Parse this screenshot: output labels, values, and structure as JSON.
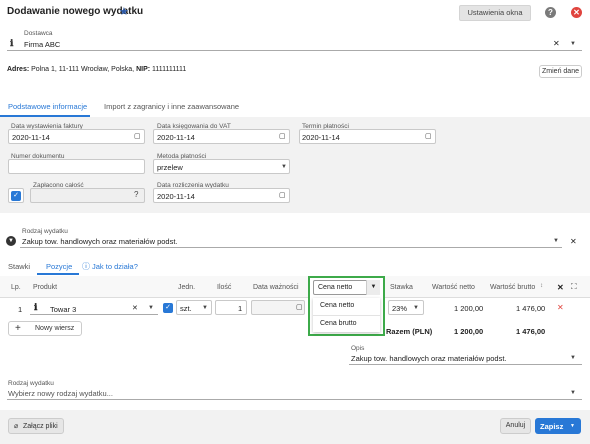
{
  "window": {
    "title": "Dodawanie nowego wydatku",
    "settings_label": "Ustawienia okna",
    "help_glyph": "?",
    "close_glyph": "✕"
  },
  "supplier": {
    "label": "Dostawca",
    "value": "Firma ABC",
    "address_prefix": "Adres:",
    "address": "Polna 1, 11-111 Wrocław, Polska,",
    "nip_label": "NIP:",
    "nip": "1111111111",
    "change_label": "Zmień dane"
  },
  "tabs": [
    "Podstawowe informacje",
    "Import z zagranicy i inne zaawansowane"
  ],
  "form": {
    "invoice_date_label": "Data wystawienia faktury",
    "invoice_date": "2020-11-14",
    "vat_date_label": "Data księgowania do VAT",
    "vat_date": "2020-11-14",
    "due_date_label": "Termin płatności",
    "due_date": "2020-11-14",
    "doc_no_label": "Numer dokumentu",
    "doc_no": "",
    "payment_label": "Metoda płatności",
    "payment": "przelew",
    "paid_label": "Zapłacono całość",
    "paid_help": "?",
    "settle_label": "Data rozliczenia wydatku",
    "settle_date": "2020-11-14"
  },
  "expense_type": {
    "label": "Rodzaj wydatku",
    "value": "Zakup tow. handlowych oraz materiałów podst."
  },
  "subtabs": {
    "rates": "Stawki",
    "items": "Pozycje",
    "how": "Jak to działa?"
  },
  "table": {
    "headers": {
      "lp": "Lp.",
      "product": "Produkt",
      "unit": "Jedn.",
      "qty": "Ilość",
      "validity": "Data ważności",
      "price": "Cena netto",
      "rate": "Stawka",
      "net": "Wartość netto",
      "gross": "Wartość brutto"
    },
    "row": {
      "lp": "1",
      "product": "Towar 3",
      "unit": "szt.",
      "qty": "1",
      "rate": "23%",
      "net": "1 200,00",
      "gross": "1 476,00"
    },
    "add_row": "Nowy wiersz",
    "total_label": "Razem (PLN)",
    "total_net": "1 200,00",
    "total_gross": "1 476,00"
  },
  "price_dropdown": {
    "options": [
      "Cena netto",
      "Cena brutto"
    ]
  },
  "description": {
    "label": "Opis",
    "value": "Zakup tow. handlowych oraz materiałów podst."
  },
  "new_expense_type": {
    "label": "Rodzaj wydatku",
    "placeholder": "Wybierz nowy rodzaj wydatku..."
  },
  "footer": {
    "attach": "Załącz pliki",
    "cancel": "Anuluj",
    "save": "Zapisz"
  },
  "colors": {
    "accent": "#2878d6",
    "highlight": "#3daa4a",
    "danger": "#e0443e"
  }
}
